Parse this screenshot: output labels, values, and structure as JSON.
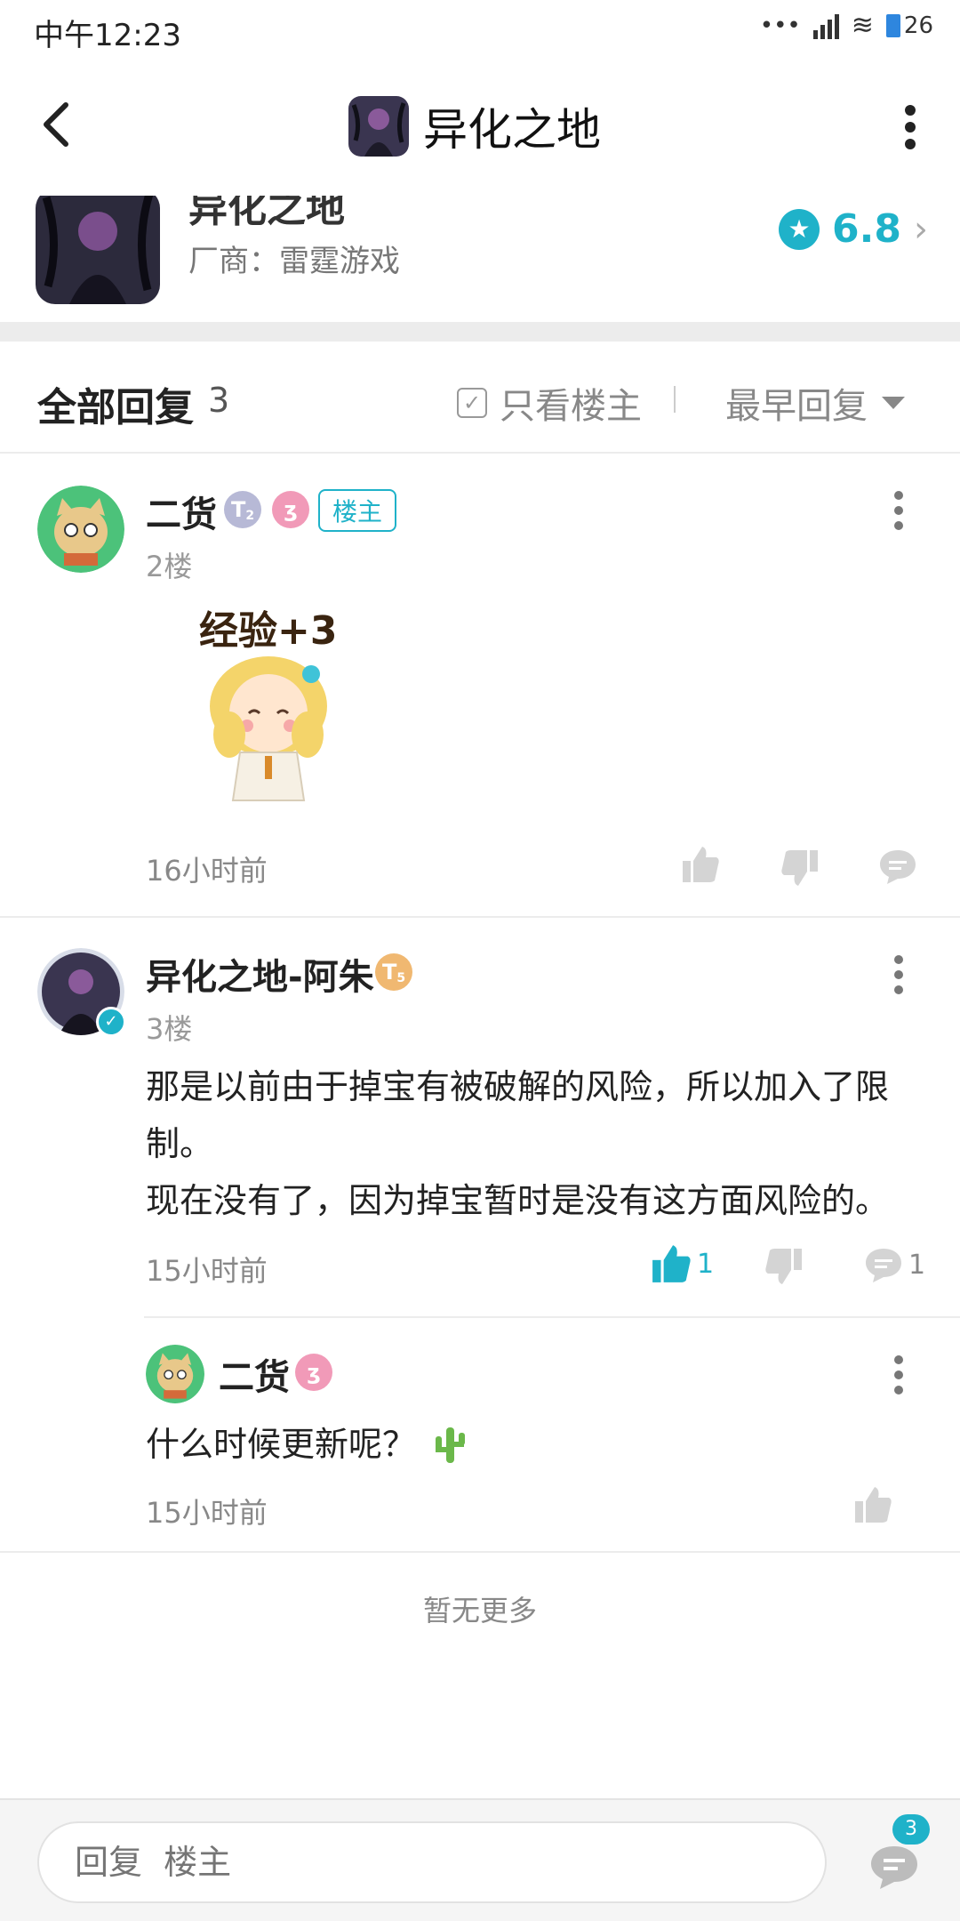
{
  "status_bar": {
    "time": "中午12:23",
    "battery": "26"
  },
  "nav": {
    "title": "异化之地"
  },
  "game": {
    "name": "异化之地",
    "vendor": "厂商：雷霆游戏",
    "rating": "6.8"
  },
  "replies_header": {
    "title": "全部回复",
    "count": "3",
    "op_only_label": "只看楼主",
    "sort_label": "最早回复"
  },
  "comments": [
    {
      "username": "二货",
      "level_badge": "T",
      "level_sub": "2",
      "tag": "楼主",
      "floor": "2楼",
      "sticker_text": "经验+3",
      "time": "16小时前"
    },
    {
      "username": "异化之地-阿朱",
      "level_badge": "T",
      "level_sub": "5",
      "floor": "3楼",
      "text_line1": "那是以前由于掉宝有被破解的风险，所以加入了限制。",
      "text_line2": "现在没有了，因为掉宝暂时是没有这方面风险的。",
      "time": "15小时前",
      "likes": "1",
      "replies": "1"
    }
  ],
  "sub_reply": {
    "username": "二货",
    "text": "什么时候更新呢？",
    "time": "15小时前"
  },
  "footer": {
    "no_more": "暂无更多"
  },
  "bottom_bar": {
    "input_placeholder": "回复  楼主",
    "comment_count": "3"
  },
  "colors": {
    "accent": "#1fb2c9",
    "band": "#ececec"
  }
}
